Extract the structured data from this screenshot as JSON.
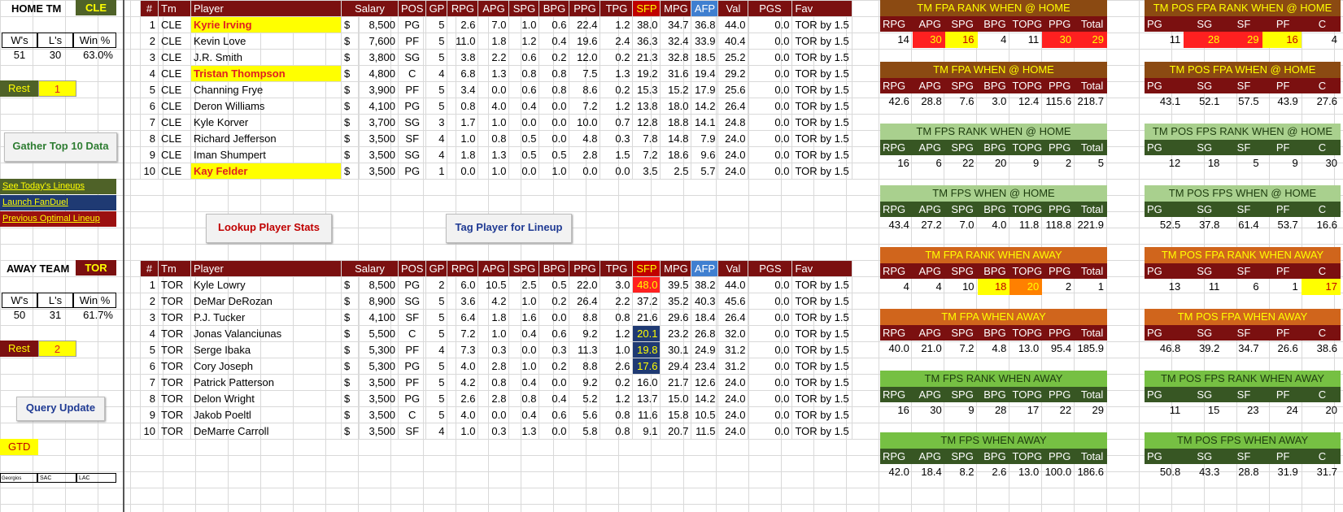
{
  "home": {
    "title": "HOME TM",
    "team": "CLE",
    "wl_headers": [
      "W's",
      "L's",
      "Win %"
    ],
    "wl_values": [
      "51",
      "30",
      "63.0%"
    ],
    "rest_label": "Rest",
    "rest_value": "1"
  },
  "away": {
    "title": "AWAY TEAM",
    "team": "TOR",
    "wl_headers": [
      "W's",
      "L's",
      "Win %"
    ],
    "wl_values": [
      "50",
      "31",
      "61.7%"
    ],
    "rest_label": "Rest",
    "rest_value": "2"
  },
  "buttons": {
    "gather": "Gather Top 10 Data",
    "lookup": "Lookup Player Stats",
    "tag": "Tag Player for Lineup",
    "query": "Query Update"
  },
  "links": {
    "lineups": "See Today's Lineups",
    "fanduel": "Launch FanDuel",
    "previous": "Previous Optimal Lineup"
  },
  "gtd_label": "GTD",
  "bottom_cells": [
    "Georgios Papagi",
    "SAC",
    "LAC"
  ],
  "player_headers": [
    "#",
    "Tm",
    "Player",
    "Salary",
    "POS",
    "GP",
    "RPG",
    "APG",
    "SPG",
    "BPG",
    "PPG",
    "TPG",
    "SFP",
    "MPG",
    "AFP",
    "Val",
    "PGS",
    "Fav"
  ],
  "home_players": [
    [
      "1",
      "CLE",
      "Kyrie Irving",
      "$",
      "8,500",
      "PG",
      "5",
      "2.6",
      "7.0",
      "1.0",
      "0.6",
      "22.4",
      "1.2",
      "38.0",
      "34.7",
      "36.8",
      "44.0",
      "0.0",
      "TOR by 1.5"
    ],
    [
      "2",
      "CLE",
      "Kevin Love",
      "$",
      "7,600",
      "PF",
      "5",
      "11.0",
      "1.8",
      "1.2",
      "0.4",
      "19.6",
      "2.4",
      "36.3",
      "32.4",
      "33.9",
      "40.4",
      "0.0",
      "TOR by 1.5"
    ],
    [
      "3",
      "CLE",
      "J.R. Smith",
      "$",
      "3,800",
      "SG",
      "5",
      "3.8",
      "2.2",
      "0.6",
      "0.2",
      "12.0",
      "0.2",
      "21.3",
      "32.8",
      "18.5",
      "25.2",
      "0.0",
      "TOR by 1.5"
    ],
    [
      "4",
      "CLE",
      "Tristan Thompson",
      "$",
      "4,800",
      "C",
      "4",
      "6.8",
      "1.3",
      "0.8",
      "0.8",
      "7.5",
      "1.3",
      "19.2",
      "31.6",
      "19.4",
      "29.2",
      "0.0",
      "TOR by 1.5"
    ],
    [
      "5",
      "CLE",
      "Channing Frye",
      "$",
      "3,900",
      "PF",
      "5",
      "3.4",
      "0.0",
      "0.6",
      "0.8",
      "8.6",
      "0.2",
      "15.3",
      "15.2",
      "17.9",
      "25.6",
      "0.0",
      "TOR by 1.5"
    ],
    [
      "6",
      "CLE",
      "Deron Williams",
      "$",
      "4,100",
      "PG",
      "5",
      "0.8",
      "4.0",
      "0.4",
      "0.0",
      "7.2",
      "1.2",
      "13.8",
      "18.0",
      "14.2",
      "26.4",
      "0.0",
      "TOR by 1.5"
    ],
    [
      "7",
      "CLE",
      "Kyle Korver",
      "$",
      "3,700",
      "SG",
      "3",
      "1.7",
      "1.0",
      "0.0",
      "0.0",
      "10.0",
      "0.7",
      "12.8",
      "18.8",
      "14.1",
      "24.8",
      "0.0",
      "TOR by 1.5"
    ],
    [
      "8",
      "CLE",
      "Richard Jefferson",
      "$",
      "3,500",
      "SF",
      "4",
      "1.0",
      "0.8",
      "0.5",
      "0.0",
      "4.8",
      "0.3",
      "7.8",
      "14.8",
      "7.9",
      "24.0",
      "0.0",
      "TOR by 1.5"
    ],
    [
      "9",
      "CLE",
      "Iman Shumpert",
      "$",
      "3,500",
      "SG",
      "4",
      "1.8",
      "1.3",
      "0.5",
      "0.5",
      "2.8",
      "1.5",
      "7.2",
      "18.6",
      "9.6",
      "24.0",
      "0.0",
      "TOR by 1.5"
    ],
    [
      "10",
      "CLE",
      "Kay Felder",
      "$",
      "3,500",
      "PG",
      "1",
      "0.0",
      "1.0",
      "0.0",
      "1.0",
      "0.0",
      "0.0",
      "3.5",
      "2.5",
      "5.7",
      "24.0",
      "0.0",
      "TOR by 1.5"
    ]
  ],
  "away_players": [
    [
      "1",
      "TOR",
      "Kyle Lowry",
      "$",
      "8,500",
      "PG",
      "2",
      "6.0",
      "10.5",
      "2.5",
      "0.5",
      "22.0",
      "3.0",
      "48.0",
      "39.5",
      "38.2",
      "44.0",
      "0.0",
      "TOR by 1.5"
    ],
    [
      "2",
      "TOR",
      "DeMar DeRozan",
      "$",
      "8,900",
      "SG",
      "5",
      "3.6",
      "4.2",
      "1.0",
      "0.2",
      "26.4",
      "2.2",
      "37.2",
      "35.2",
      "40.3",
      "45.6",
      "0.0",
      "TOR by 1.5"
    ],
    [
      "3",
      "TOR",
      "P.J. Tucker",
      "$",
      "4,100",
      "SF",
      "5",
      "6.4",
      "1.8",
      "1.6",
      "0.0",
      "8.8",
      "0.8",
      "21.6",
      "29.6",
      "18.4",
      "26.4",
      "0.0",
      "TOR by 1.5"
    ],
    [
      "4",
      "TOR",
      "Jonas Valanciunas",
      "$",
      "5,500",
      "C",
      "5",
      "7.2",
      "1.0",
      "0.4",
      "0.6",
      "9.2",
      "1.2",
      "20.1",
      "23.2",
      "26.8",
      "32.0",
      "0.0",
      "TOR by 1.5"
    ],
    [
      "5",
      "TOR",
      "Serge Ibaka",
      "$",
      "5,300",
      "PF",
      "4",
      "7.3",
      "0.3",
      "0.0",
      "0.3",
      "11.3",
      "1.0",
      "19.8",
      "30.1",
      "24.9",
      "31.2",
      "0.0",
      "TOR by 1.5"
    ],
    [
      "6",
      "TOR",
      "Cory Joseph",
      "$",
      "5,300",
      "PG",
      "5",
      "4.0",
      "2.8",
      "1.0",
      "0.2",
      "8.8",
      "2.6",
      "17.6",
      "29.4",
      "23.4",
      "31.2",
      "0.0",
      "TOR by 1.5"
    ],
    [
      "7",
      "TOR",
      "Patrick Patterson",
      "$",
      "3,500",
      "PF",
      "5",
      "4.2",
      "0.8",
      "0.4",
      "0.0",
      "9.2",
      "0.2",
      "16.0",
      "21.7",
      "12.6",
      "24.0",
      "0.0",
      "TOR by 1.5"
    ],
    [
      "8",
      "TOR",
      "Delon Wright",
      "$",
      "3,500",
      "PG",
      "5",
      "2.6",
      "2.8",
      "0.8",
      "0.4",
      "5.2",
      "1.2",
      "13.7",
      "15.0",
      "14.2",
      "24.0",
      "0.0",
      "TOR by 1.5"
    ],
    [
      "9",
      "TOR",
      "Jakob Poeltl",
      "$",
      "3,500",
      "C",
      "5",
      "4.0",
      "0.0",
      "0.4",
      "0.6",
      "5.6",
      "0.8",
      "11.6",
      "15.8",
      "10.5",
      "24.0",
      "0.0",
      "TOR by 1.5"
    ],
    [
      "10",
      "TOR",
      "DeMarre Carroll",
      "$",
      "3,500",
      "SF",
      "4",
      "1.0",
      "0.3",
      "1.3",
      "0.0",
      "5.8",
      "0.8",
      "9.1",
      "20.7",
      "11.5",
      "24.0",
      "0.0",
      "TOR by 1.5"
    ]
  ],
  "home_highlight_rows": [
    0,
    3,
    9
  ],
  "away_sfp_highlight": {
    "0": "red",
    "3": "navy",
    "4": "navy",
    "5": "navy"
  },
  "team_headers": [
    "RPG",
    "APG",
    "SPG",
    "BPG",
    "TOPG",
    "PPG",
    "Total"
  ],
  "pos_headers": [
    "PG",
    "SG",
    "SF",
    "PF",
    "C"
  ],
  "panels_left": [
    {
      "title": "TM FPA RANK WHEN @ HOME",
      "values": [
        "14",
        "30",
        "16",
        "4",
        "11",
        "30",
        "29"
      ],
      "style": "brown",
      "hl": {
        "1": "red",
        "2": "yel",
        "5": "red",
        "6": "red"
      }
    },
    {
      "title": "TM FPA WHEN @ HOME",
      "values": [
        "42.6",
        "28.8",
        "7.6",
        "3.0",
        "12.4",
        "115.6",
        "218.7"
      ],
      "style": "brown",
      "hl": {}
    },
    {
      "title": "TM FPS RANK WHEN @ HOME",
      "values": [
        "16",
        "6",
        "22",
        "20",
        "9",
        "2",
        "5"
      ],
      "style": "lgreen",
      "hl": {}
    },
    {
      "title": "TM FPS WHEN @ HOME",
      "values": [
        "43.4",
        "27.2",
        "7.0",
        "4.0",
        "11.8",
        "118.8",
        "221.9"
      ],
      "style": "lgreen",
      "hl": {}
    },
    {
      "title": "TM FPA RANK WHEN AWAY",
      "values": [
        "4",
        "4",
        "10",
        "18",
        "20",
        "2",
        "1"
      ],
      "style": "orange",
      "hl": {
        "3": "yel",
        "4": "org"
      }
    },
    {
      "title": "TM FPA WHEN AWAY",
      "values": [
        "40.0",
        "21.0",
        "7.2",
        "4.8",
        "13.0",
        "95.4",
        "185.9"
      ],
      "style": "orange",
      "hl": {}
    },
    {
      "title": "TM FPS RANK WHEN AWAY",
      "values": [
        "16",
        "30",
        "9",
        "28",
        "17",
        "22",
        "29"
      ],
      "style": "green",
      "hl": {}
    },
    {
      "title": "TM FPS WHEN AWAY",
      "values": [
        "42.0",
        "18.4",
        "8.2",
        "2.6",
        "13.0",
        "100.0",
        "186.6"
      ],
      "style": "green",
      "hl": {}
    }
  ],
  "panels_right": [
    {
      "title": "TM POS FPA RANK WHEN @ HOME",
      "values": [
        "11",
        "28",
        "29",
        "16",
        "4"
      ],
      "style": "brown",
      "hl": {
        "1": "red",
        "2": "red",
        "3": "yel"
      }
    },
    {
      "title": "TM POS FPA WHEN @ HOME",
      "values": [
        "43.1",
        "52.1",
        "57.5",
        "43.9",
        "27.6"
      ],
      "style": "brown",
      "hl": {}
    },
    {
      "title": "TM POS FPS RANK WHEN @ HOME",
      "values": [
        "12",
        "18",
        "5",
        "9",
        "30"
      ],
      "style": "lgreen",
      "hl": {}
    },
    {
      "title": "TM POS FPS WHEN @ HOME",
      "values": [
        "52.5",
        "37.8",
        "61.4",
        "53.7",
        "16.6"
      ],
      "style": "lgreen",
      "hl": {}
    },
    {
      "title": "TM POS FPA RANK WHEN AWAY",
      "values": [
        "13",
        "11",
        "6",
        "1",
        "17"
      ],
      "style": "orange",
      "hl": {
        "4": "yel"
      }
    },
    {
      "title": "TM POS FPA WHEN AWAY",
      "values": [
        "46.8",
        "39.2",
        "34.7",
        "26.6",
        "38.6"
      ],
      "style": "orange",
      "hl": {}
    },
    {
      "title": "TM POS FPS RANK WHEN AWAY",
      "values": [
        "11",
        "15",
        "23",
        "24",
        "20"
      ],
      "style": "green",
      "hl": {}
    },
    {
      "title": "TM POS FPS WHEN AWAY",
      "values": [
        "50.8",
        "43.3",
        "28.8",
        "31.9",
        "31.7"
      ],
      "style": "green",
      "hl": {}
    }
  ],
  "colors": {
    "header_dark_red": "#7b1010",
    "team_green": "#4f6228",
    "brown_title": "#8b4a12",
    "orange_title": "#d0651c",
    "light_green_title": "#a9d08e",
    "green_title": "#76c043",
    "highlight_yellow": "#ffff00",
    "highlight_red": "#ff2020",
    "sfp_navy": "#1f3a73"
  }
}
